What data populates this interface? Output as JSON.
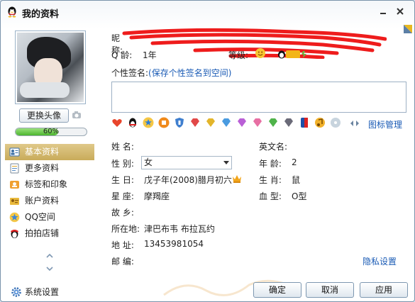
{
  "window": {
    "title": "我的资料",
    "minimize_label": "-",
    "close_label": "×"
  },
  "profile": {
    "change_avatar": "更换头像",
    "completion": 0.6,
    "completion_text": "60%"
  },
  "nav": {
    "items": [
      {
        "label": "基本资料",
        "icon": "profile-card-icon",
        "active": true
      },
      {
        "label": "更多资料",
        "icon": "document-icon",
        "active": false
      },
      {
        "label": "标签和印象",
        "icon": "tag-icon",
        "active": false
      },
      {
        "label": "账户资料",
        "icon": "account-icon",
        "active": false
      },
      {
        "label": "QQ空间",
        "icon": "qzone-star-icon",
        "active": false
      },
      {
        "label": "拍拍店铺",
        "icon": "shop-icon",
        "active": false
      }
    ],
    "settings": "系统设置"
  },
  "header": {
    "nick_label": "昵称:",
    "qage_label": "Q 龄:",
    "qage_value": "1年",
    "level_label": "等级:",
    "signature_label": "个性签名:",
    "signature_link": "(保存个性签名到空间)",
    "icon_mgmt": "图标管理"
  },
  "fields": {
    "name_label": "姓    名:",
    "name_value": "",
    "english_name_label": "英文名:",
    "english_name_value": "",
    "gender_label": "性    别:",
    "gender_value": "女",
    "age_label": "年    龄:",
    "age_value": "2",
    "birthday_label": "生    日:",
    "birthday_value": "戊子年(2008)腊月初六",
    "zodiac_label": "生    肖:",
    "zodiac_value": "鼠",
    "constellation_label": "星    座:",
    "constellation_value": "摩羯座",
    "blood_label": "血    型:",
    "blood_value": "O型",
    "hometown_label": "故    乡:",
    "hometown_value": "",
    "location_label": "所在地:",
    "location_value": "津巴布韦  布拉瓦约",
    "address_label": "地    址:",
    "address_value": "13453981054",
    "postcode_label": "邮    编:",
    "postcode_value": "",
    "privacy_link": "隐私设置"
  },
  "buttons": {
    "ok": "确定",
    "cancel": "取消",
    "apply": "应用"
  },
  "colors": {
    "accent": "#1a5bb5",
    "active_nav": "#c9ab5a",
    "progress": "#4cb52e",
    "redaction": "#ee1c1c"
  }
}
